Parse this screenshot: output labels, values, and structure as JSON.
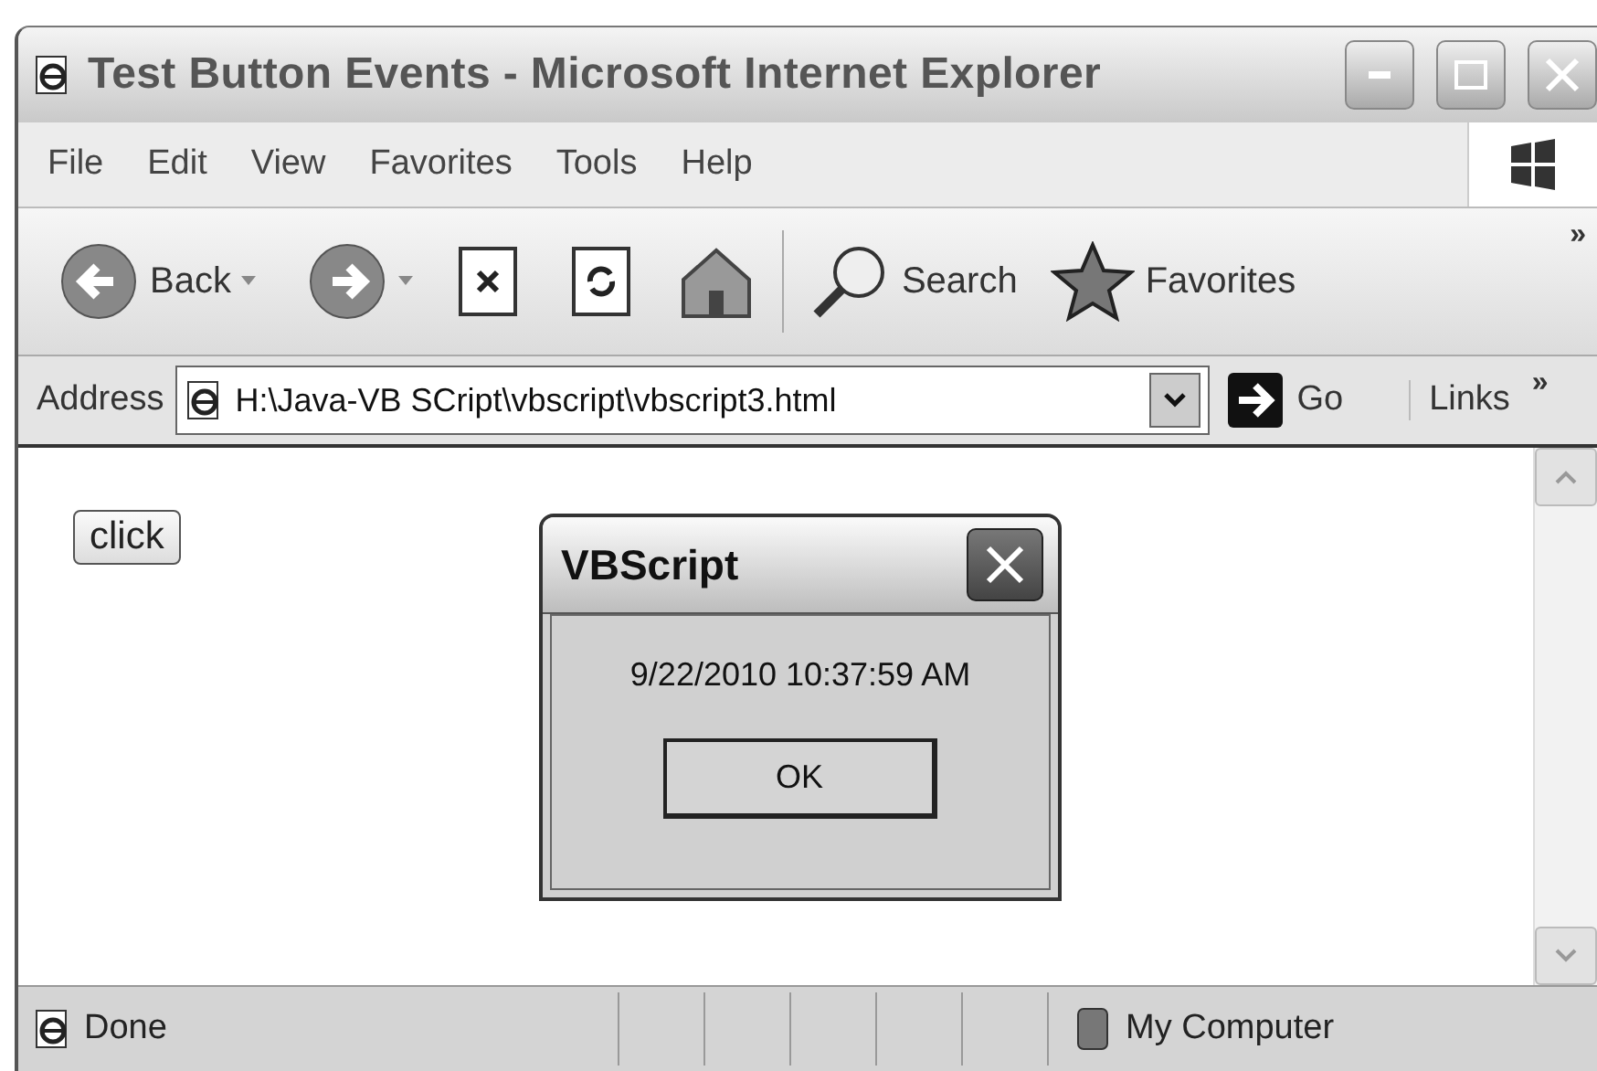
{
  "window": {
    "title": "Test Button Events - Microsoft Internet Explorer"
  },
  "menu": [
    "File",
    "Edit",
    "View",
    "Favorites",
    "Tools",
    "Help"
  ],
  "toolbar": {
    "back": "Back",
    "search": "Search",
    "favorites": "Favorites",
    "more": "»"
  },
  "address": {
    "label": "Address",
    "value": "H:\\Java-VB SCript\\vbscript\\vbscript3.html",
    "go": "Go",
    "links": "Links",
    "more": "»"
  },
  "page": {
    "button": "click"
  },
  "dialog": {
    "title": "VBScript",
    "message": "9/22/2010 10:37:59 AM",
    "ok": "OK"
  },
  "status_bar": {
    "text": "Done",
    "zone": "My Computer"
  }
}
